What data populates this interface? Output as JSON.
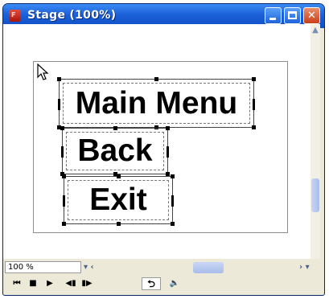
{
  "window": {
    "title": "Stage (100%)",
    "app_icon": "flash-app-icon"
  },
  "title_buttons": {
    "minimize": "minimize-icon",
    "maximize": "maximize-icon",
    "close_glyph": "✕"
  },
  "stage": {
    "buttons": [
      {
        "label": "Main Menu"
      },
      {
        "label": "Back"
      },
      {
        "label": "Exit"
      }
    ]
  },
  "statusbar": {
    "zoom_value": "100 %",
    "zoom_arrow": "▾ ‹",
    "scroll_right": "› ▾"
  },
  "controls": {
    "rewind": "⏮",
    "stop": "■",
    "play": "▶",
    "step_back": "◀▮",
    "step_forward": "▮▶",
    "loop": "⮌",
    "sound": "🔈"
  }
}
